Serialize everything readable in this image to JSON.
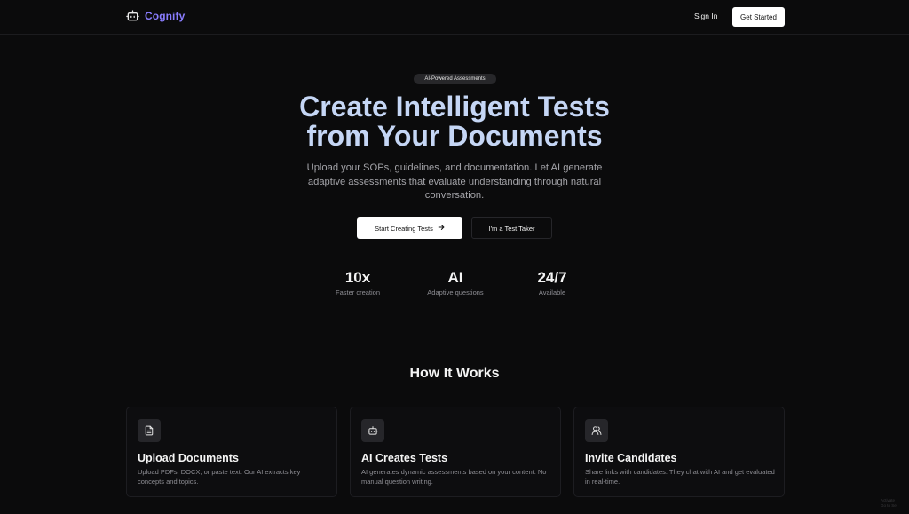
{
  "app": {
    "name": "Cognify",
    "brand_color": "#8a7dff"
  },
  "icons": {
    "logo": "bot-icon",
    "cta_arrow": "arrow-right-icon",
    "upload": "document-icon",
    "ai": "bot-icon",
    "invite": "users-icon"
  },
  "nav": {
    "signin_label": "Sign In",
    "getstarted_label": "Get Started"
  },
  "hero": {
    "badge": "AI-Powered Assessments",
    "title_line1": "Create Intelligent Tests",
    "title_line2": "from Your Documents",
    "subtitle": "Upload your SOPs, guidelines, and documentation. Let AI generate adaptive assessments that evaluate understanding through natural conversation.",
    "primary_cta": "Start Creating Tests",
    "secondary_cta": "I'm a Test Taker"
  },
  "stats": [
    {
      "value": "10x",
      "label": "Faster creation"
    },
    {
      "value": "AI",
      "label": "Adaptive questions"
    },
    {
      "value": "24/7",
      "label": "Available"
    }
  ],
  "how_it_works": {
    "title": "How It Works",
    "cards": [
      {
        "title": "Upload Documents",
        "desc": "Upload PDFs, DOCX, or paste text. Our AI extracts key concepts and topics."
      },
      {
        "title": "AI Creates Tests",
        "desc": "AI generates dynamic assessments based on your content. No manual question writing."
      },
      {
        "title": "Invite Candidates",
        "desc": "Share links with candidates. They chat with AI and get evaluated in real-time."
      }
    ]
  },
  "watermark": {
    "line1": "Activate",
    "line2": "Go to Set"
  }
}
